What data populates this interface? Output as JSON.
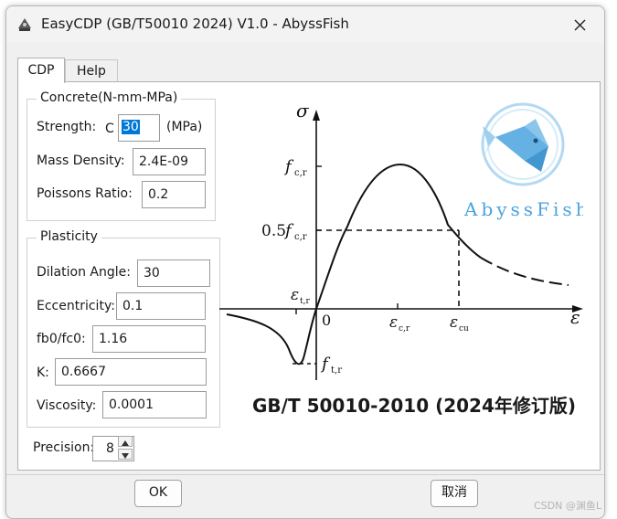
{
  "window": {
    "title": "EasyCDP (GB/T50010 2024) V1.0 - AbyssFish"
  },
  "tabs": [
    {
      "label": "CDP",
      "active": true
    },
    {
      "label": "Help",
      "active": false
    }
  ],
  "concrete": {
    "title": "Concrete(N-mm-MPa)",
    "strength_label": "Strength:",
    "strength_prefix": "C",
    "strength_value": "30",
    "strength_unit": "(MPa)",
    "density_label": "Mass Density:",
    "density_value": "2.4E-09",
    "poisson_label": "Poissons Ratio:",
    "poisson_value": "0.2"
  },
  "plasticity": {
    "title": "Plasticity",
    "dilation_label": "Dilation Angle:",
    "dilation_value": "30",
    "eccentricity_label": "Eccentricity:",
    "eccentricity_value": "0.1",
    "fb0_label": "fb0/fc0:",
    "fb0_value": "1.16",
    "k_label": "K:",
    "k_value": "0.6667",
    "viscosity_label": "Viscosity:",
    "viscosity_value": "0.0001"
  },
  "precision": {
    "label": "Precision:",
    "value": "8"
  },
  "figure": {
    "sigma": "σ",
    "epsilon": "ε",
    "fcr": "f",
    "fcr_sub": "c,r",
    "half_fcr_prefix": "0.5",
    "half_fcr_f": "f",
    "half_fcr_sub": "c,r",
    "eps_tr": "ε",
    "eps_tr_sub": "t,r",
    "zero": "0",
    "eps_cr": "ε",
    "eps_cr_sub": "c,r",
    "eps_cu": "ε",
    "eps_cu_sub": "cu",
    "ftr": "f",
    "ftr_sub": "t,r",
    "logo_text": "AbyssFish",
    "caption": "GB/T 50010-2010 (2024年修订版)"
  },
  "buttons": {
    "ok": "OK",
    "cancel": "取消"
  },
  "watermark": "CSDN @渊鱼L",
  "colors": {
    "accent": "#0078d7",
    "logo": "#4aa3df"
  }
}
